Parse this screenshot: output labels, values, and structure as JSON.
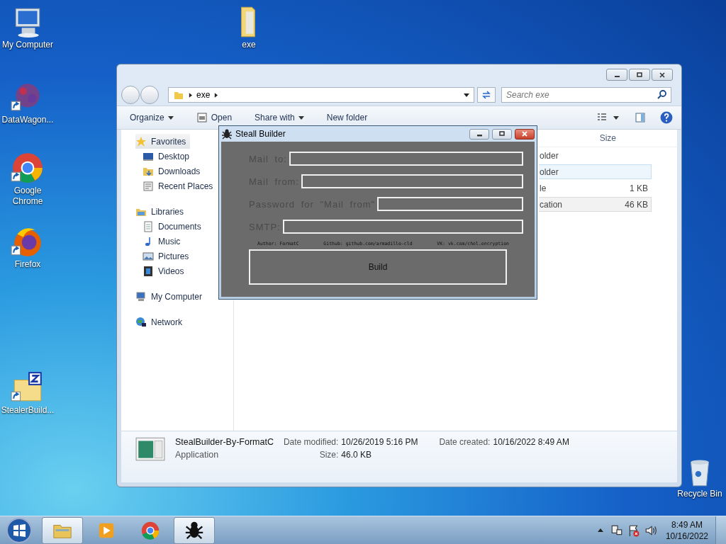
{
  "desktop": {
    "icons": [
      {
        "label": "My Computer",
        "kind": "computer",
        "shortcut": false
      },
      {
        "label": "exe",
        "kind": "folder",
        "shortcut": false
      },
      {
        "label": "DataWagon...",
        "kind": "cluster",
        "shortcut": true
      },
      {
        "label": "Google Chrome",
        "kind": "chrome",
        "shortcut": true
      },
      {
        "label": "Firefox",
        "kind": "firefox",
        "shortcut": true
      },
      {
        "label": "StealerBuild...",
        "kind": "archive",
        "shortcut": true
      },
      {
        "label": "Recycle Bin",
        "kind": "recycle",
        "shortcut": false
      }
    ]
  },
  "explorer": {
    "address": [
      "exe"
    ],
    "search": {
      "placeholder": "Search exe"
    },
    "toolbar": [
      {
        "label": "Organize",
        "kind": "menu"
      },
      {
        "label": "Open",
        "kind": "open"
      },
      {
        "label": "Share with",
        "kind": "menu"
      },
      {
        "label": "New folder",
        "kind": "plain"
      }
    ],
    "nav": [
      {
        "label": "Favorites",
        "kind": "star",
        "selected": true,
        "children": [
          {
            "label": "Desktop",
            "kind": "desktop",
            "selected": false
          },
          {
            "label": "Downloads",
            "kind": "downloads",
            "selected": false
          },
          {
            "label": "Recent Places",
            "kind": "recent",
            "selected": false
          }
        ]
      },
      {
        "label": "Libraries",
        "kind": "libraries",
        "selected": false,
        "children": [
          {
            "label": "Documents",
            "kind": "documents",
            "selected": false
          },
          {
            "label": "Music",
            "kind": "music",
            "selected": false
          },
          {
            "label": "Pictures",
            "kind": "pictures",
            "selected": false
          },
          {
            "label": "Videos",
            "kind": "videos",
            "selected": false
          }
        ]
      },
      {
        "label": "My Computer",
        "kind": "computer",
        "selected": false
      },
      {
        "label": "Network",
        "kind": "network",
        "selected": false
      }
    ],
    "list": {
      "columns": [
        "Size"
      ],
      "rows": [
        {
          "name": "older",
          "selected": false,
          "hot": false
        },
        {
          "name": "older",
          "selected": false,
          "hot": true
        },
        {
          "name": "le",
          "size": "1 KB",
          "selected": false,
          "hot": false
        },
        {
          "name": "cation",
          "size": "46 KB",
          "selected": true,
          "hot": false
        }
      ]
    },
    "details": {
      "name": "StealBuilder-By-FormatC",
      "type": "Application",
      "modified_label": "Date modified:",
      "modified": "10/26/2019 5:16 PM",
      "size_label": "Size:",
      "size": "46.0 KB",
      "created_label": "Date created:",
      "created": "10/16/2022 8:49 AM"
    }
  },
  "builder": {
    "title": "Steall Builder",
    "fields": [
      {
        "label": "Mail to:"
      },
      {
        "label": "Mail from:"
      },
      {
        "label": "Password for \"Mail from\""
      },
      {
        "label": "SMTP:"
      }
    ],
    "credits": [
      "Author: FormatC",
      "Github: github.com/armadillo-cld",
      "VK: vk.com/chel.encryption"
    ],
    "button": "Build"
  },
  "taskbar": {
    "items": [
      {
        "kind": "explorer",
        "active": true
      },
      {
        "kind": "media",
        "active": false
      },
      {
        "kind": "chrome",
        "active": false
      },
      {
        "kind": "bug",
        "active": true
      }
    ],
    "time": "8:49 AM",
    "date": "10/16/2022"
  }
}
